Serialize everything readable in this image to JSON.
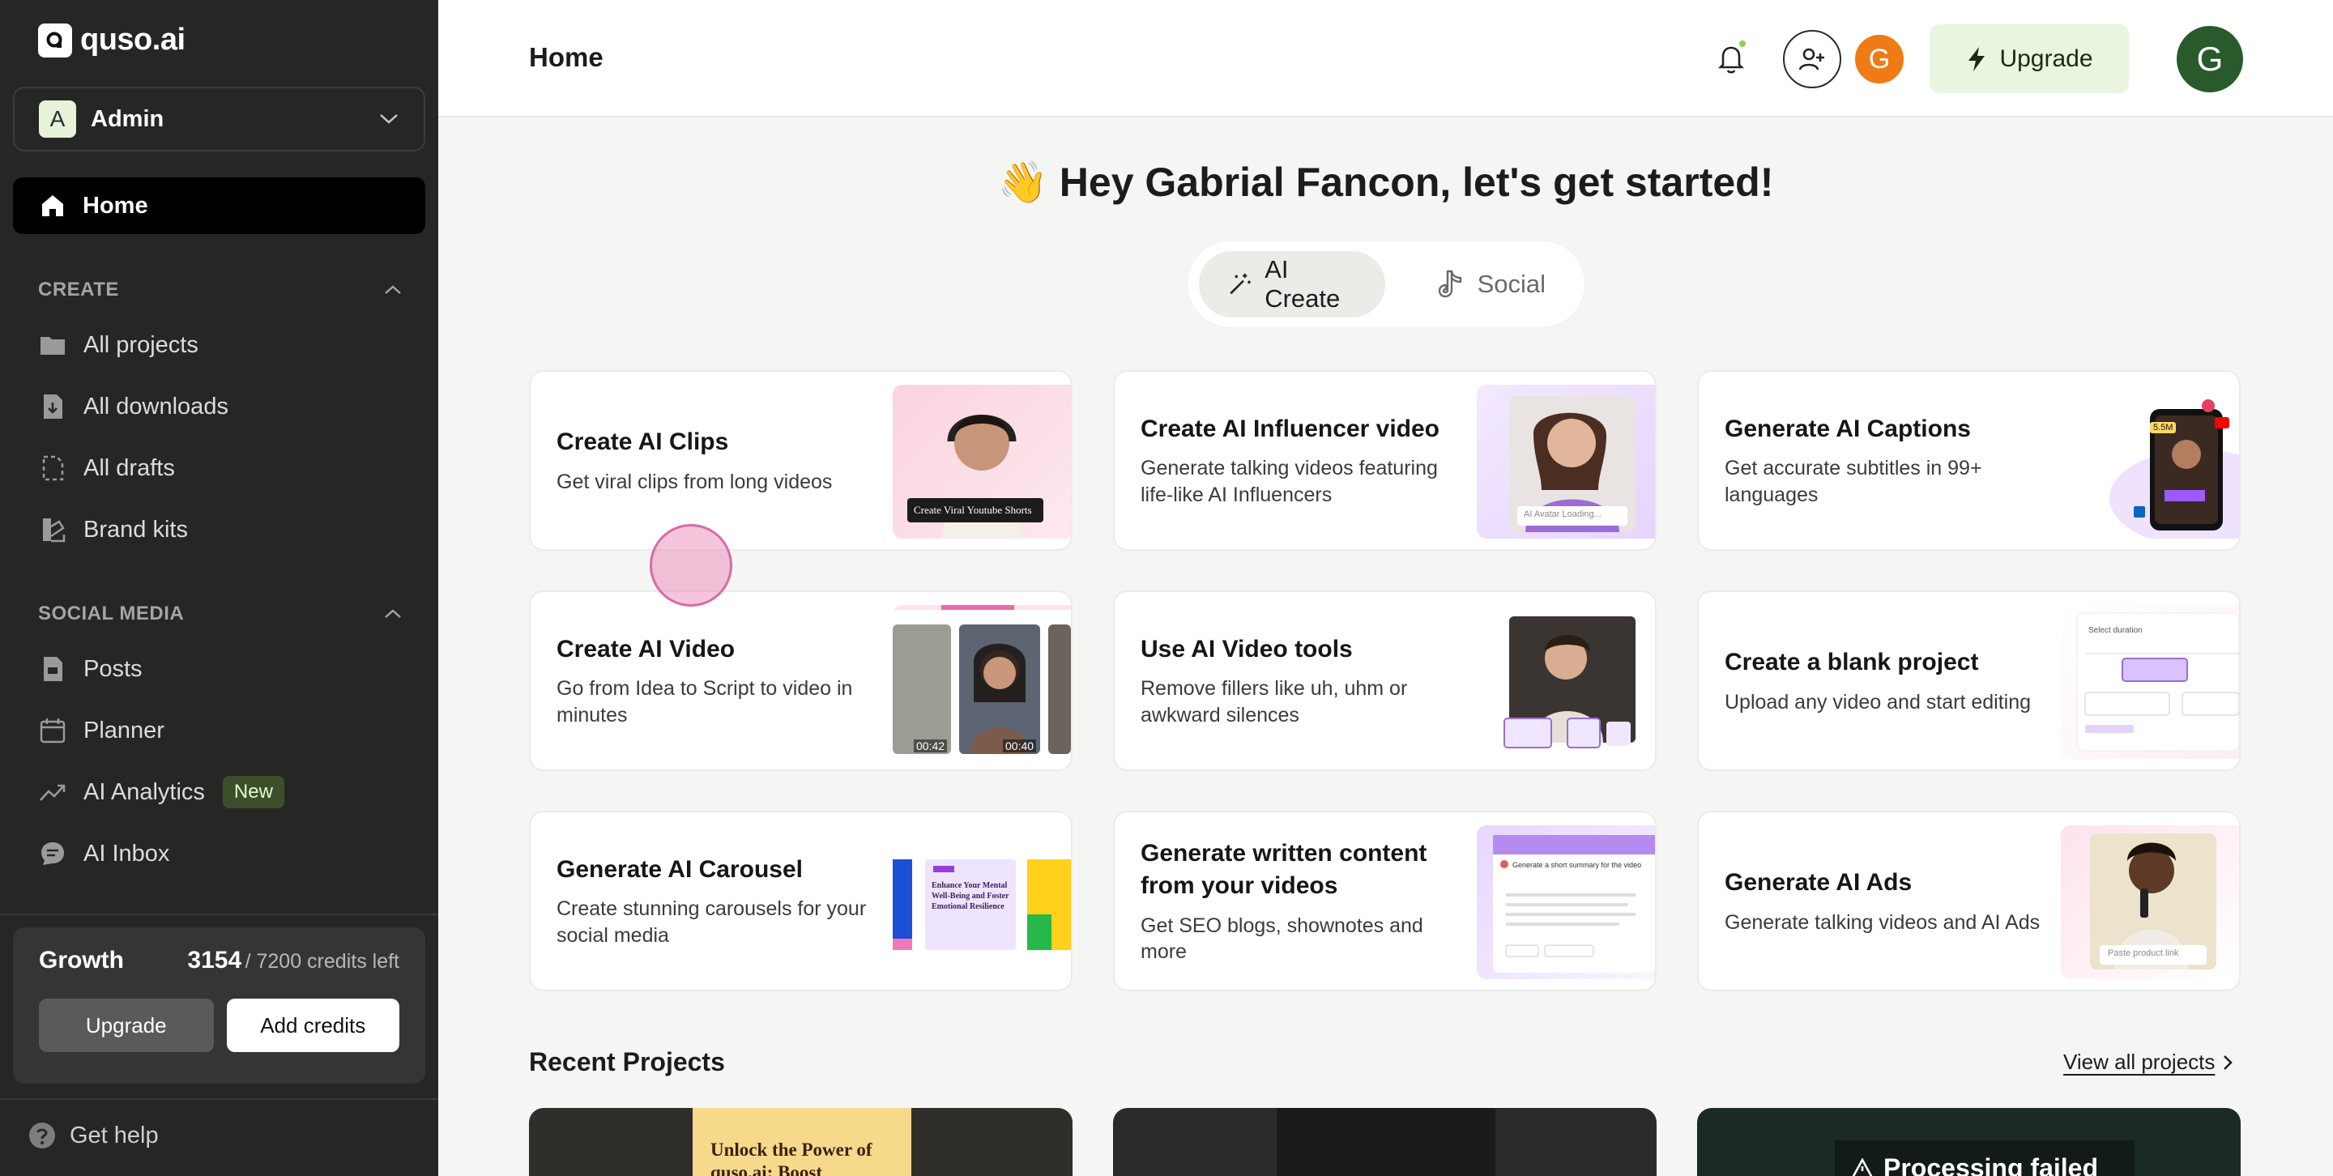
{
  "brand": {
    "name": "quso.ai"
  },
  "workspace": {
    "initial": "A",
    "name": "Admin"
  },
  "sidebar": {
    "home": "Home",
    "create_section": "CREATE",
    "create_items": [
      {
        "label": "All projects",
        "icon": "folder-icon"
      },
      {
        "label": "All downloads",
        "icon": "download-file-icon"
      },
      {
        "label": "All drafts",
        "icon": "draft-icon"
      },
      {
        "label": "Brand kits",
        "icon": "brand-kit-icon"
      }
    ],
    "social_section": "SOCIAL MEDIA",
    "social_items": [
      {
        "label": "Posts",
        "icon": "posts-icon"
      },
      {
        "label": "Planner",
        "icon": "calendar-icon"
      },
      {
        "label": "AI Analytics",
        "icon": "trend-icon",
        "badge": "New"
      },
      {
        "label": "AI Inbox",
        "icon": "chat-icon"
      }
    ],
    "credits": {
      "plan": "Growth",
      "used": "3154",
      "rest": "/ 7200 credits left",
      "upgrade": "Upgrade",
      "add": "Add credits"
    },
    "help": "Get help"
  },
  "header": {
    "title": "Home",
    "mini_avatar": "G",
    "upgrade": "Upgrade",
    "user_initial": "G"
  },
  "main": {
    "greeting": "👋 Hey Gabrial Fancon, let's get started!",
    "tabs": [
      {
        "label": "AI Create",
        "active": true
      },
      {
        "label": "Social",
        "active": false
      }
    ],
    "cards": [
      {
        "title": "Create AI Clips",
        "desc": "Get viral clips from long videos",
        "thumb_caption": "Create Viral Youtube Shorts"
      },
      {
        "title": "Create AI Influencer video",
        "desc": "Generate talking videos featuring life-like AI Influencers",
        "thumb_caption": "AI Avatar Loading..."
      },
      {
        "title": "Generate AI Captions",
        "desc": "Get accurate subtitles in 99+ languages",
        "thumb_caption": "5.5M"
      },
      {
        "title": "Create AI Video",
        "desc": "Go from Idea to Script to video in minutes",
        "thumb_caption": "00:42",
        "thumb_caption2": "00:40"
      },
      {
        "title": "Use AI Video tools",
        "desc": "Remove fillers like uh, uhm or awkward silences"
      },
      {
        "title": "Create a blank project",
        "desc": "Upload any video and start editing",
        "thumb_caption": "Select duration"
      },
      {
        "title": "Generate AI Carousel",
        "desc": "Create stunning carousels for your social media",
        "thumb_caption": "Enhance Your Mental Well-Being and Foster Emotional Resilience"
      },
      {
        "title": "Generate written content from your videos",
        "desc": "Get SEO blogs, shownotes and more",
        "thumb_caption": "Generate a short summary for the video"
      },
      {
        "title": "Generate AI Ads",
        "desc": "Generate talking videos and AI Ads",
        "thumb_caption": "Paste product link"
      }
    ],
    "recent_title": "Recent Projects",
    "view_all": "View all projects",
    "projects": [
      {
        "caption": "Unlock the Power of quso.ai: Boost"
      },
      {
        "caption": ""
      },
      {
        "caption": "Processing failed"
      }
    ]
  },
  "colors": {
    "sidebar_bg": "#262725",
    "accent_green": "#e9f5de",
    "avatar_orange": "#f07b16",
    "user_avatar": "#285a2b"
  }
}
